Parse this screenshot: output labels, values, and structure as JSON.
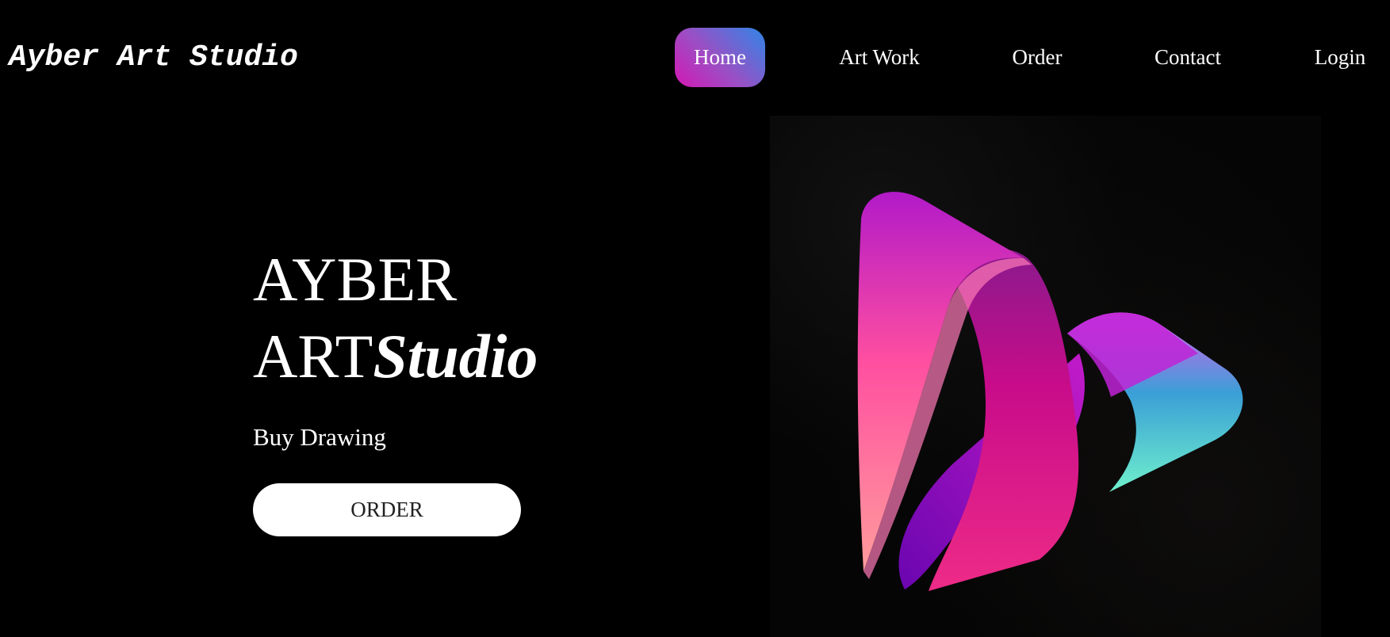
{
  "brand": {
    "name": "Ayber Art Studio"
  },
  "nav": {
    "items": [
      {
        "label": "Home",
        "active": true
      },
      {
        "label": "Art Work",
        "active": false
      },
      {
        "label": "Order",
        "active": false
      },
      {
        "label": "Contact",
        "active": false
      },
      {
        "label": "Login",
        "active": false
      }
    ]
  },
  "hero": {
    "title_line1": "AYBER",
    "title_line2_regular": "ART",
    "title_line2_emphasis": "Studio",
    "subtitle": "Buy Drawing",
    "cta_label": "ORDER",
    "logo_image": "abstract-play-ribbon-logo"
  },
  "colors": {
    "background": "#000000",
    "text": "#ffffff",
    "nav_active_gradient_start": "#d418b4",
    "nav_active_gradient_end": "#2f86e6",
    "button_bg": "#ffffff",
    "button_text": "#222222",
    "logo_magenta": "#e0288c",
    "logo_purple": "#7a0fb0",
    "logo_teal": "#4fe0c8"
  }
}
